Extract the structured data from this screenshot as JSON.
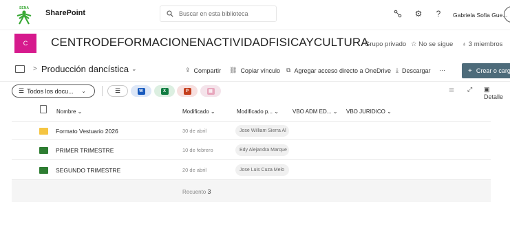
{
  "suite": {
    "app_name": "SharePoint",
    "search_placeholder": "Buscar en esta biblioteca",
    "user_name": "Gabriela Sofia Gue..."
  },
  "site": {
    "logo_letter": "C",
    "logo_color": "#d61a8d",
    "title": "CENTRODEFORMACIONENACTIVIDADFISICAYCULTURA",
    "privacy": "Grupo privado",
    "follow_label": "No se sigue",
    "members_label": "3 miembros"
  },
  "command_bar": {
    "breadcrumb_sep": ">",
    "library_name": "Producción dancística",
    "share": "Compartir",
    "copy_link": "Copiar vínculo",
    "shortcut": "Agregar acceso directo a OneDrive",
    "download": "Descargar",
    "more": "···",
    "new_button": "Crear o carga"
  },
  "view": {
    "current_view": "Todos los docu...",
    "details_label": "Detalle"
  },
  "table": {
    "columns": {
      "name": "Nombre",
      "modified": "Modificado",
      "modified_by": "Modificado p...",
      "vbo_adm": "VBO ADM ED...",
      "vbo_juridico": "VBO JURIDICO"
    },
    "rows": [
      {
        "name": "Formato Vestuario 2026",
        "modified": "30 de abril",
        "modified_by": "Jose William Sierra Al",
        "folder_color": "#f5c542"
      },
      {
        "name": "PRIMER TRIMESTRE",
        "modified": "10 de febrero",
        "modified_by": "Edy Alejandra Marque",
        "folder_color": "#2e7d32"
      },
      {
        "name": "SEGUNDO TRIMESTRE",
        "modified": "20 de abril",
        "modified_by": "Jose Luis Cuza Melo",
        "folder_color": "#2e7d32"
      }
    ],
    "count_label": "Recuento",
    "count_value": "3"
  },
  "colors": {
    "accent": "#4d6b7a",
    "sena_green": "#39a935"
  }
}
